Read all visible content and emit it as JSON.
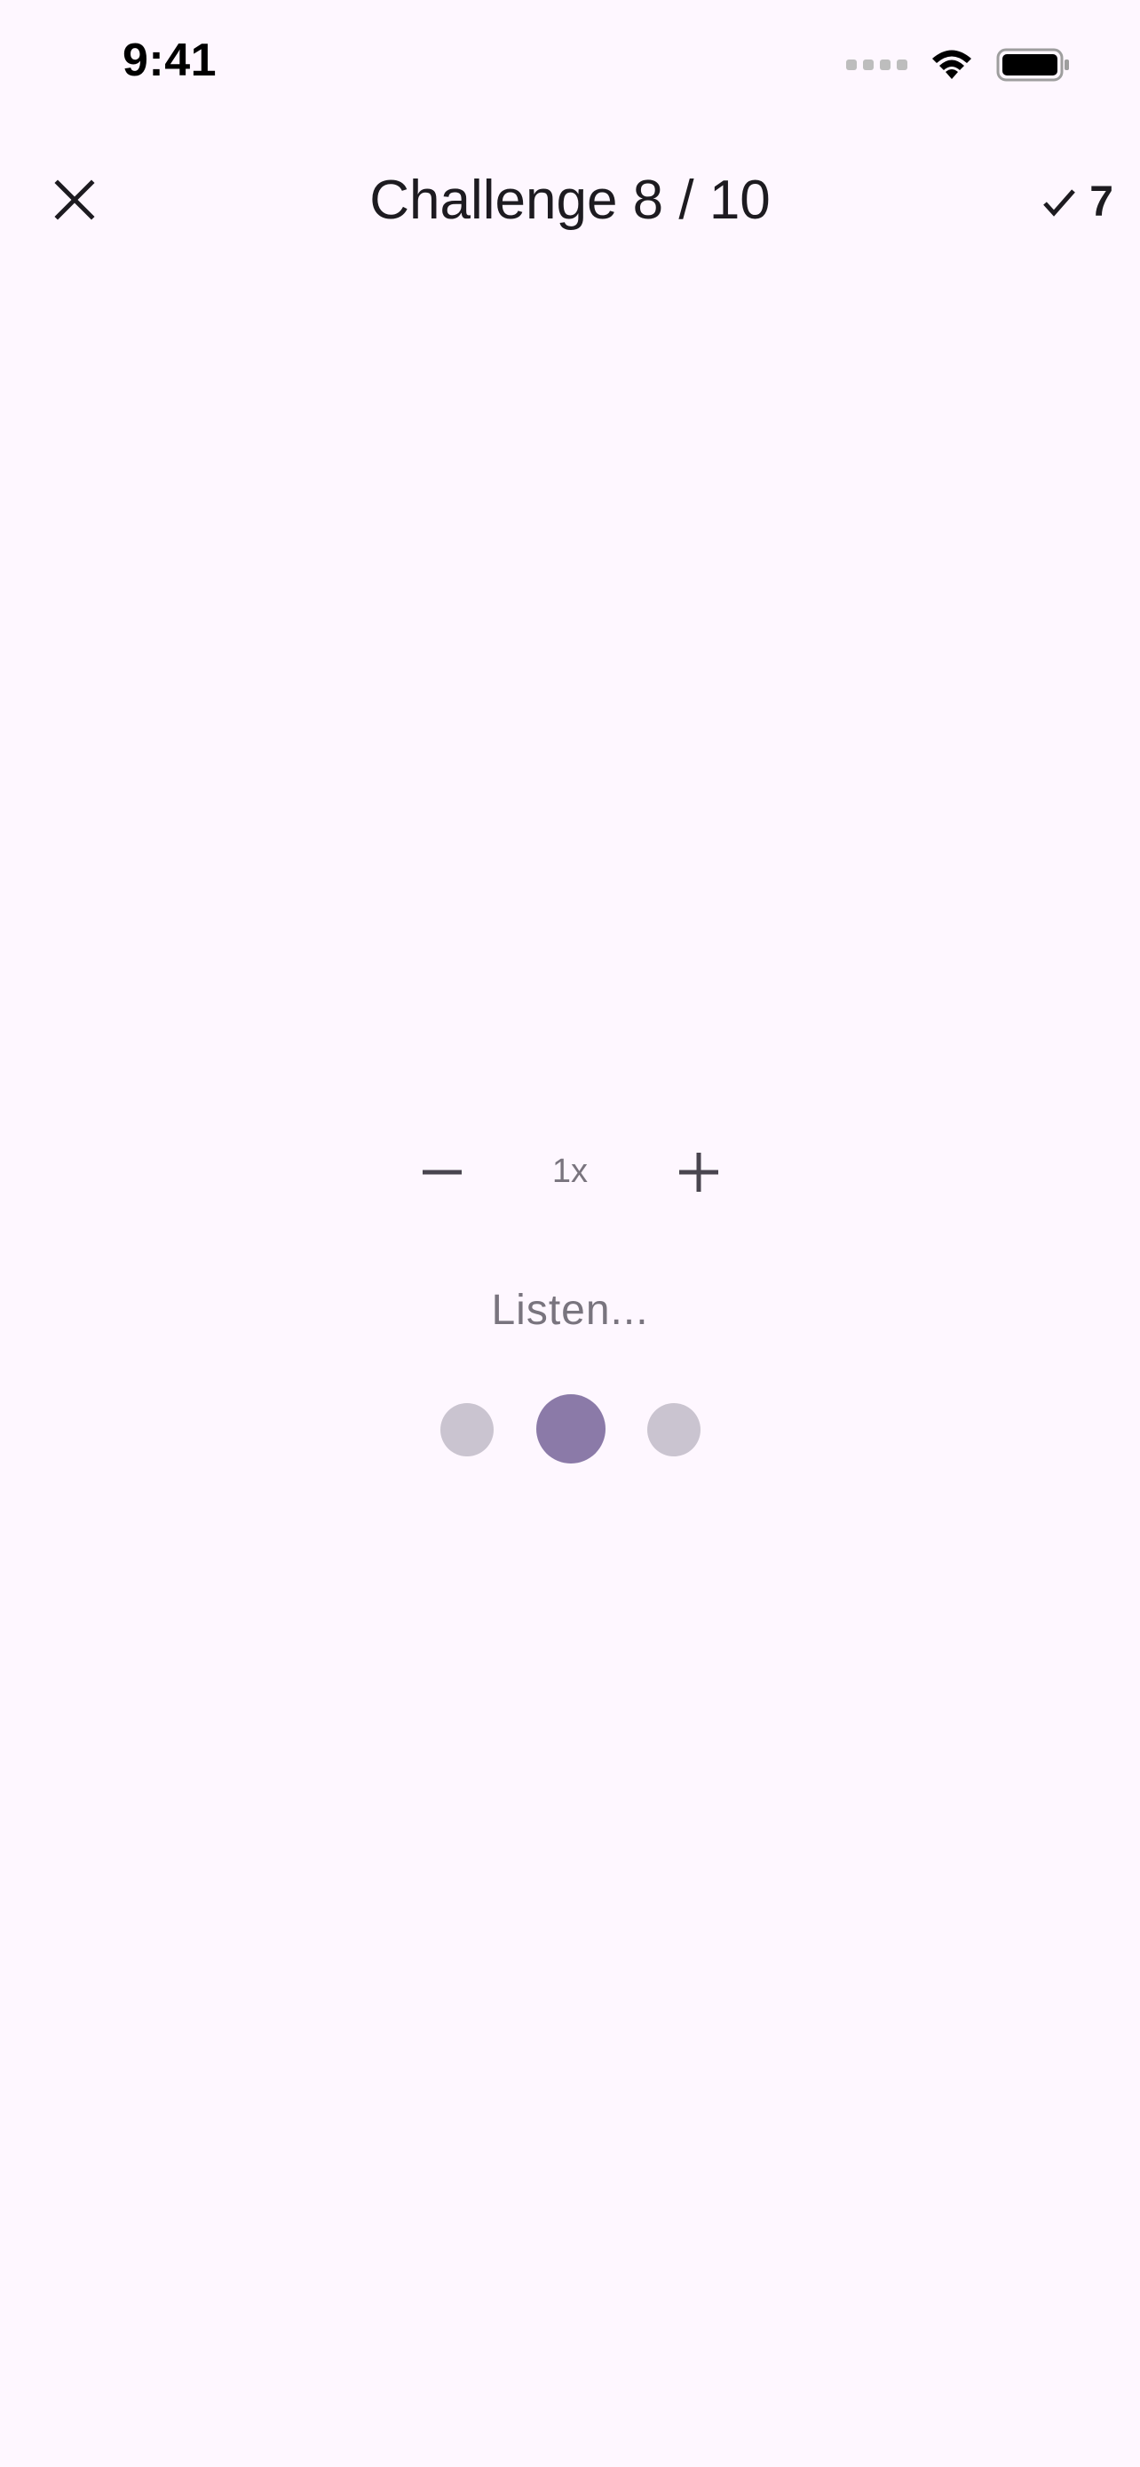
{
  "status_bar": {
    "time": "9:41"
  },
  "app_bar": {
    "title": "Challenge 8 / 10",
    "score_value": "7",
    "close_icon": "close-icon",
    "check_icon": "check-icon"
  },
  "speed": {
    "label": "1x",
    "minus_icon": "minus-icon",
    "plus_icon": "plus-icon"
  },
  "listen": {
    "label": "Listen..."
  },
  "indicator": {
    "dot_count": 3,
    "active_index": 1,
    "active_color": "#8B7AA8",
    "inactive_color": "#CAC4D0"
  },
  "colors": {
    "background": "#FEF7FF",
    "text_primary": "#1D1B20",
    "text_secondary": "#79747E"
  }
}
